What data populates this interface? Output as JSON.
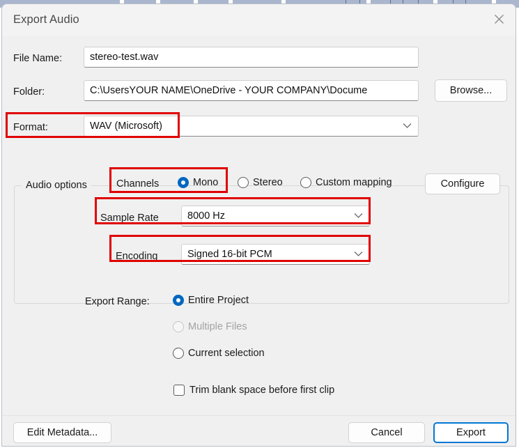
{
  "window": {
    "title": "Export Audio",
    "close_icon": "close-icon"
  },
  "fields": {
    "file_name": {
      "label": "File Name:",
      "value": "stereo-test.wav"
    },
    "folder": {
      "label": "Folder:",
      "value": "C:\\UsersYOUR NAME\\OneDrive - YOUR COMPANY\\Docume",
      "browse_label": "Browse..."
    },
    "format": {
      "label": "Format:",
      "value": "WAV (Microsoft)"
    }
  },
  "audio_options": {
    "group_label": "Audio options",
    "channels": {
      "label": "Channels",
      "options": [
        {
          "label": "Mono",
          "selected": true,
          "disabled": false
        },
        {
          "label": "Stereo",
          "selected": false,
          "disabled": false
        },
        {
          "label": "Custom mapping",
          "selected": false,
          "disabled": false
        }
      ],
      "configure_label": "Configure"
    },
    "sample_rate": {
      "label": "Sample Rate",
      "value": "8000 Hz"
    },
    "encoding": {
      "label": "Encoding",
      "value": "Signed 16-bit PCM"
    }
  },
  "export_range": {
    "label": "Export Range:",
    "options": [
      {
        "label": "Entire Project",
        "selected": true,
        "disabled": false
      },
      {
        "label": "Multiple Files",
        "selected": false,
        "disabled": true
      },
      {
        "label": "Current selection",
        "selected": false,
        "disabled": false
      }
    ]
  },
  "trim": {
    "label": "Trim blank space before first clip",
    "checked": false
  },
  "footer": {
    "edit_metadata_label": "Edit Metadata...",
    "cancel_label": "Cancel",
    "export_label": "Export"
  },
  "colors": {
    "accent": "#0067c0",
    "default_button_border": "#0078d4",
    "annotation": "#e00000",
    "dialog_bg": "#f0f0f0",
    "titlebar_bg": "#f3f3f3"
  }
}
